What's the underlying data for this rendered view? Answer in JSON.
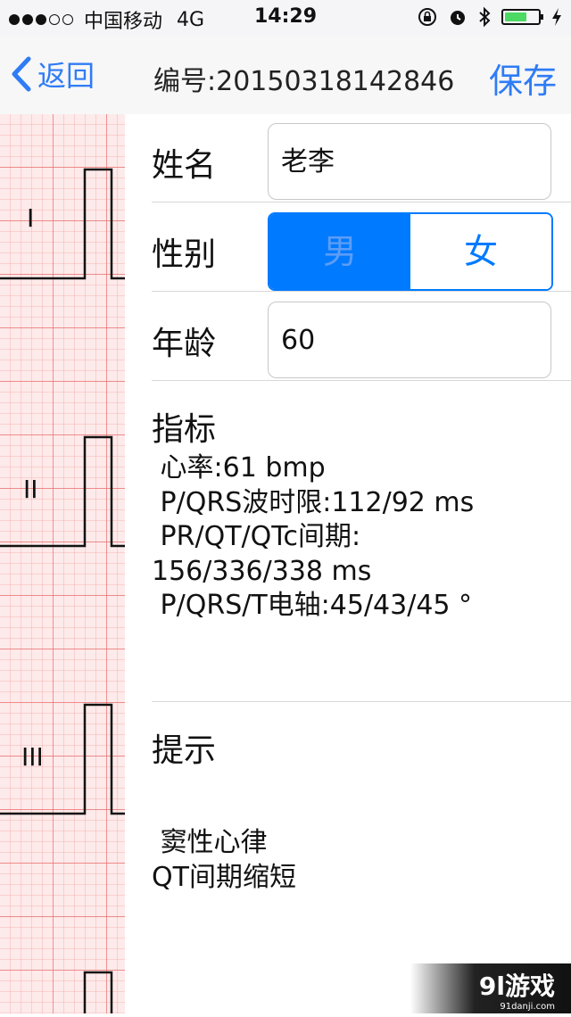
{
  "status_bar": {
    "carrier": "中国移动",
    "network": "4G",
    "time": "14:29"
  },
  "nav": {
    "back_label": "返回",
    "title": "编号:20150318142846",
    "save_label": "保存"
  },
  "form": {
    "name_label": "姓名",
    "name_value": "老李",
    "gender_label": "性别",
    "gender_options": [
      "男",
      "女"
    ],
    "gender_selected": "男",
    "age_label": "年龄",
    "age_value": "60"
  },
  "metrics": {
    "title": "指标",
    "lines": [
      " 心率:61 bmp",
      " P/QRS波时限:112/92 ms",
      " PR/QT/QTc间期:",
      "156/336/338 ms",
      " P/QRS/T电轴:45/43/45 °"
    ]
  },
  "hints": {
    "title": "提示",
    "lines": [
      " 窦性心律",
      "QT间期缩短"
    ]
  },
  "ecg": {
    "leads": [
      "I",
      "II",
      "III"
    ]
  },
  "watermark": {
    "main": "9l游戏",
    "sub": "91danji.com"
  },
  "colors": {
    "accent": "#007aff",
    "grid": "#f08a8a",
    "grid_bg": "#fdeaea"
  }
}
